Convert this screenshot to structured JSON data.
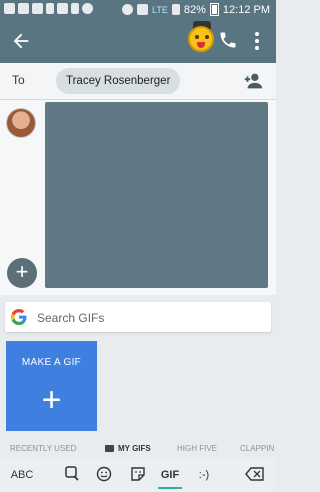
{
  "status_bar": {
    "network": "LTE",
    "battery": "82%",
    "time": "12:12 PM"
  },
  "app_bar": {
    "back_icon": "arrow-back-icon",
    "call_icon": "phone-icon",
    "menu_icon": "more-vert-icon"
  },
  "to_bar": {
    "label": "To",
    "recipient": "Tracey Rosenberger",
    "add_icon": "add-person-icon"
  },
  "composer": {
    "attach_icon": "plus-icon"
  },
  "gif_panel": {
    "search_placeholder": "Search GIFs",
    "make_gif_label": "MAKE A GIF",
    "categories": [
      "RECENTLY USED",
      "MY GIFS",
      "HIGH FIVE",
      "CLAPPIN"
    ],
    "active_category": "MY GIFS"
  },
  "keyboard_bar": {
    "abc": "ABC",
    "gif": "GIF",
    "emoticon": ":-)"
  },
  "colors": {
    "toolbar": "#5a7582",
    "accent": "#3f7fe0",
    "indicator": "#2bb3a0"
  }
}
